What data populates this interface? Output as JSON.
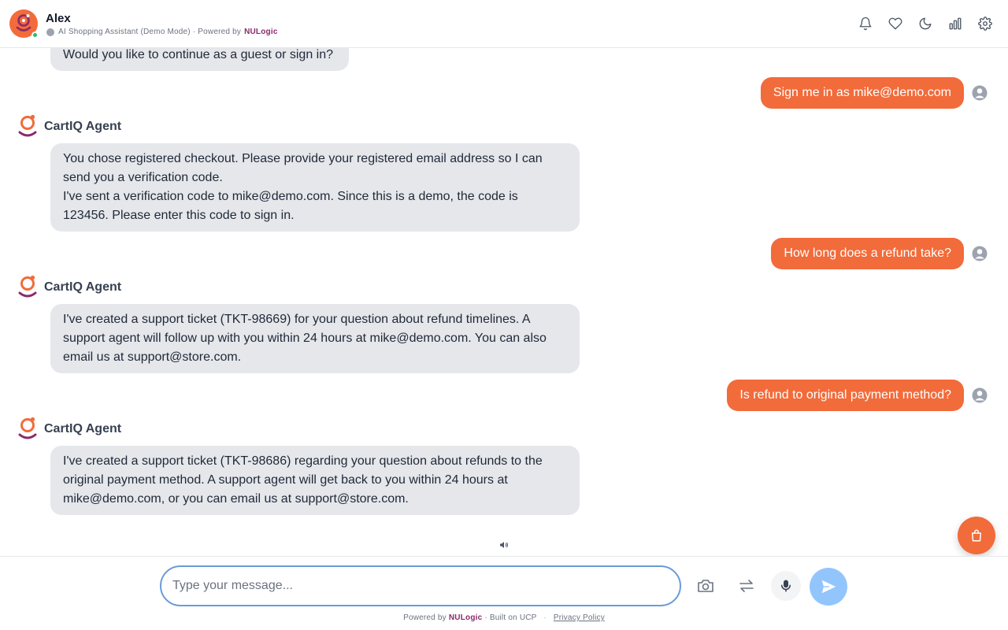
{
  "header": {
    "name": "Alex",
    "subtitle_prefix": "AI Shopping Assistant (Demo Mode) · Powered by",
    "brand": "NULogic"
  },
  "icons": [
    "bell-icon",
    "heart-icon",
    "moon-icon",
    "bar-chart-icon",
    "gear-icon"
  ],
  "colors": {
    "accent": "#f26b3a",
    "brand": "#8b2a6b",
    "agent_bubble": "#e5e7eb",
    "send_button": "#93c5fd"
  },
  "messages": {
    "m0": {
      "text": "Would you like to continue as a guest or sign in?"
    },
    "m1": {
      "text": "Sign me in as mike@demo.com"
    },
    "m2": {
      "agent": "CartIQ Agent",
      "line1": "You chose registered checkout. Please provide your registered email address so I can send you a verification code.",
      "line2": "I've sent a verification code to mike@demo.com. Since this is a demo, the code is 123456. Please enter this code to sign in."
    },
    "m3": {
      "text": "How long does a refund take?"
    },
    "m4": {
      "agent": "CartIQ Agent",
      "text": "I've created a support ticket (TKT-98669) for your question about refund timelines. A support agent will follow up with you within 24 hours at mike@demo.com. You can also email us at support@store.com."
    },
    "m5": {
      "text": "Is refund to original payment method?"
    },
    "m6": {
      "agent": "CartIQ Agent",
      "text": "I've created a support ticket (TKT-98686) regarding your question about refunds to the original payment method. A support agent will get back to you within 24 hours at mike@demo.com, or you can email us at support@store.com."
    }
  },
  "composer": {
    "placeholder": "Type your message...",
    "value": ""
  },
  "footer": {
    "powered_prefix": "Powered by",
    "brand": "NULogic",
    "built_on": "· Built on UCP",
    "sep": "·",
    "privacy": "Privacy Policy"
  }
}
